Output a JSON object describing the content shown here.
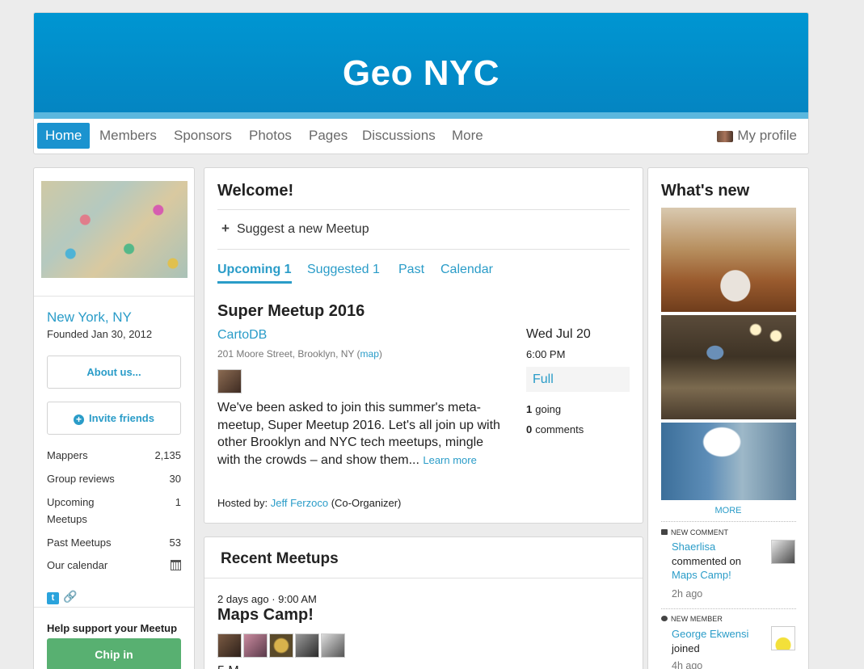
{
  "group": {
    "title": "Geo NYC"
  },
  "nav": {
    "items": [
      "Home",
      "Members",
      "Sponsors",
      "Photos",
      "Pages",
      "Discussions",
      "More"
    ],
    "profile": "My profile"
  },
  "sidebar": {
    "city": "New York, NY",
    "founded": "Founded Jan 30, 2012",
    "about_button": "About us...",
    "invite_button": "Invite friends",
    "stats": [
      {
        "label": "Mappers",
        "value": "2,135"
      },
      {
        "label": "Group reviews",
        "value": "30"
      },
      {
        "label": "Upcoming Meetups",
        "value": "1"
      },
      {
        "label": "Past Meetups",
        "value": "53"
      },
      {
        "label": "Our calendar",
        "value": ""
      }
    ],
    "support_title": "Help support your Meetup",
    "chip_in": "Chip in",
    "icons": [
      "twitter-icon",
      "link-icon",
      "calendar-icon"
    ]
  },
  "welcome": {
    "title": "Welcome!",
    "suggest": "Suggest a new Meetup",
    "tabs": [
      "Upcoming 1",
      "Suggested 1",
      "Past",
      "Calendar"
    ],
    "event": {
      "title": "Super Meetup 2016",
      "venue": "CartoDB",
      "address_prefix": "201 Moore Street, Brooklyn, NY (",
      "map_link": "map",
      "address_suffix": ")",
      "description": "We've been asked to join this summer's meta-meetup, Super Meetup 2016. Let's all join up with other Brooklyn and NYC tech meetups, mingle with the crowds – and show them...",
      "learn_more": "Learn more",
      "hosted_label": "Hosted by:",
      "host_name": "Jeff Ferzoco",
      "host_role": "(Co-Organizer)",
      "date": "Wed Jul 20",
      "time": "6:00 PM",
      "status": "Full",
      "going_count": "1",
      "going_label": "going",
      "comments_count": "0",
      "comments_label": "comments"
    }
  },
  "recent": {
    "title": "Recent Meetups",
    "when": "2 days ago · 9:00 AM",
    "name": "Maps Camp!",
    "count_text": "5 M"
  },
  "whats_new": {
    "title": "What's new",
    "more": "MORE",
    "feed": [
      {
        "type": "New comment",
        "user": "Shaerlisa",
        "action": "commented on",
        "target": "Maps Camp!",
        "time": "2h ago"
      },
      {
        "type": "New member",
        "user": "George Ekwensi",
        "action": "joined",
        "target": "",
        "time": "4h ago"
      }
    ]
  },
  "colors": {
    "brand": "#0096d2",
    "link": "#2a9cc8",
    "chip_in": "#58b071"
  }
}
